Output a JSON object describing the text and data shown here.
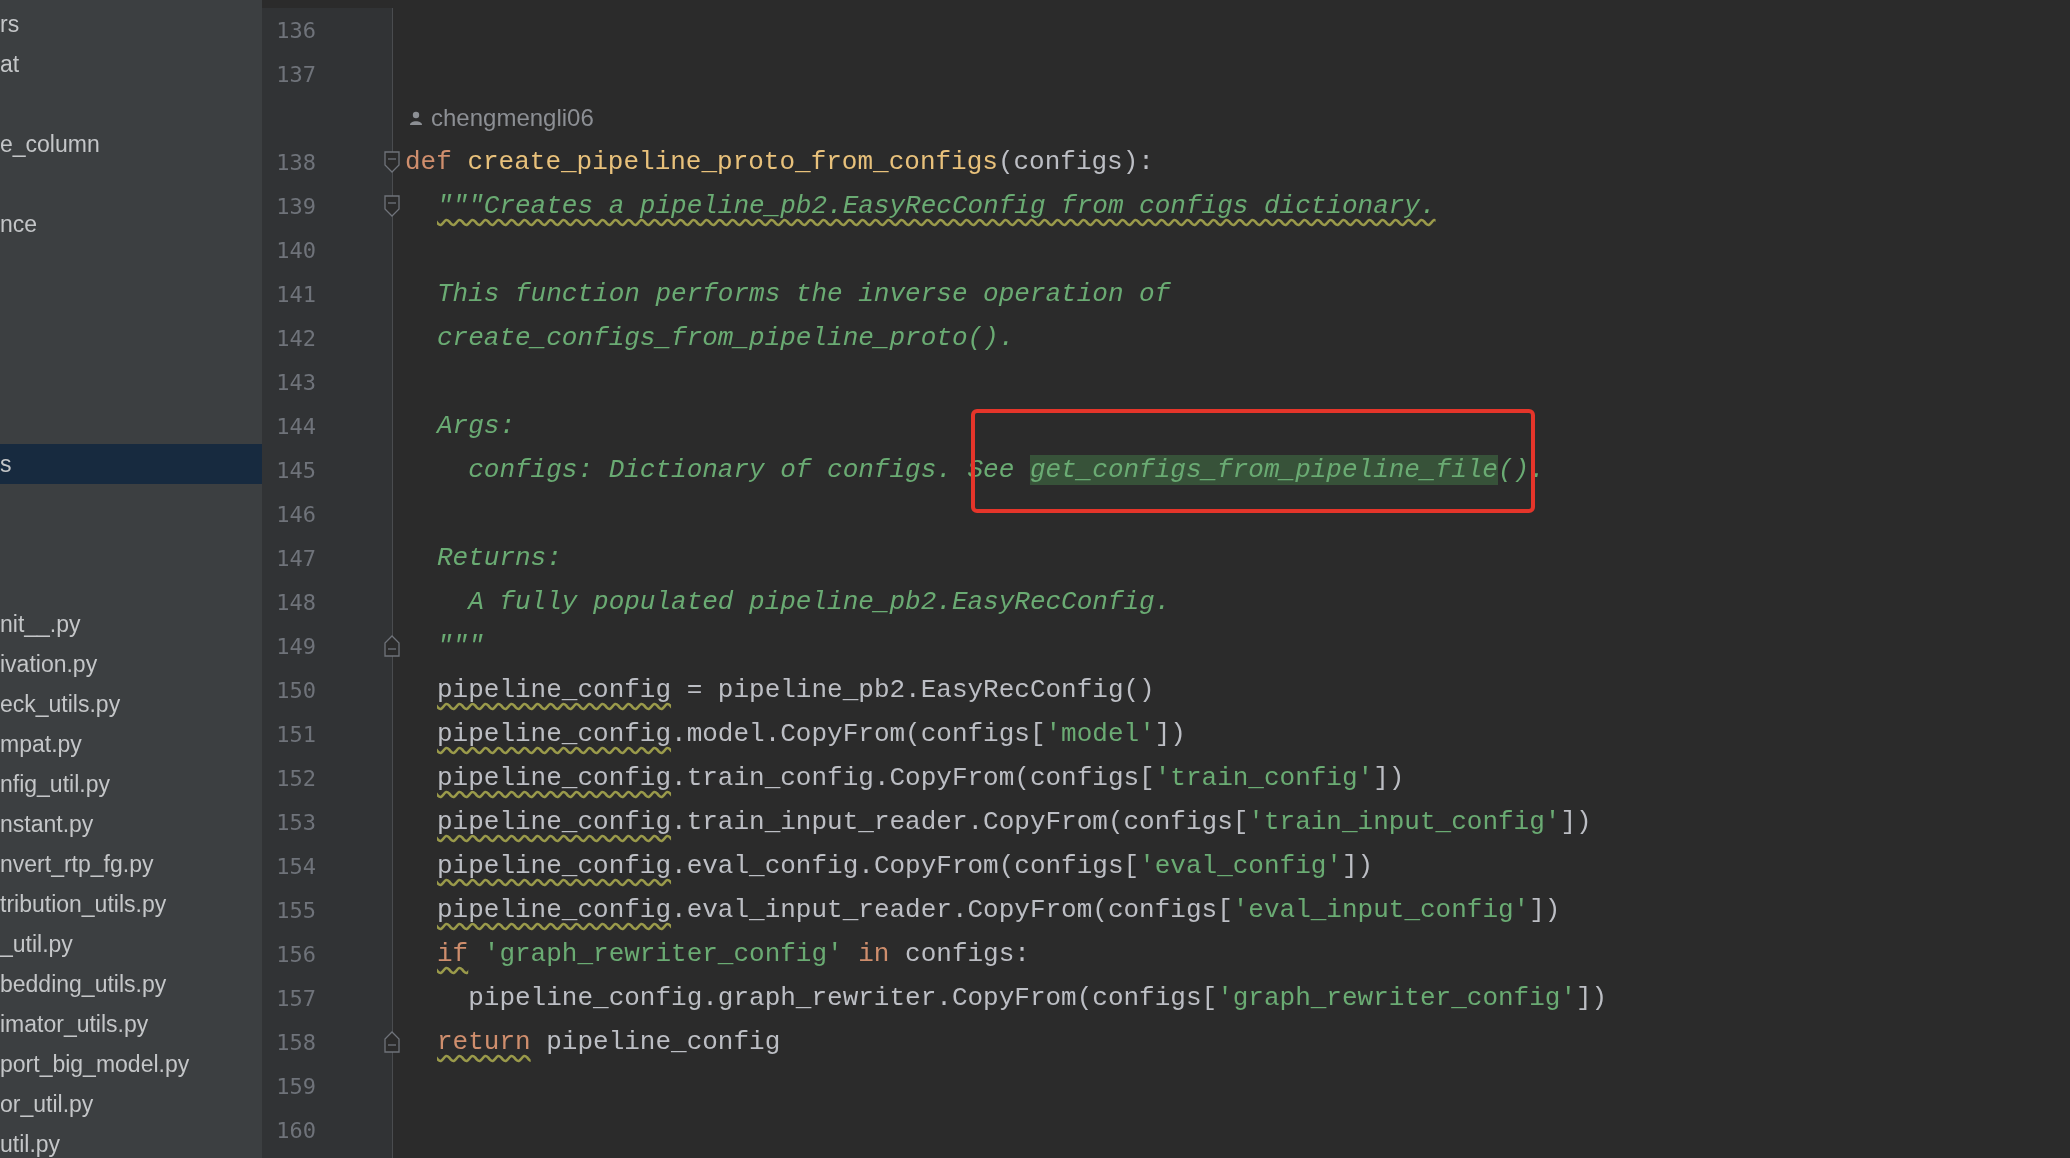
{
  "sidebar": {
    "items": [
      {
        "kind": "file",
        "label": "rs",
        "selected": false
      },
      {
        "kind": "file",
        "label": "at",
        "selected": false
      },
      {
        "kind": "hidden",
        "selected": false
      },
      {
        "kind": "file",
        "label": "e_column",
        "selected": false
      },
      {
        "kind": "hidden",
        "selected": false
      },
      {
        "kind": "file",
        "label": "nce",
        "selected": false
      },
      {
        "kind": "hidden",
        "selected": false
      },
      {
        "kind": "hidden",
        "selected": false
      },
      {
        "kind": "hidden",
        "selected": false
      },
      {
        "kind": "hidden",
        "selected": false
      },
      {
        "kind": "hidden",
        "selected": false
      },
      {
        "kind": "file",
        "label": "s",
        "selected": true
      },
      {
        "kind": "hidden",
        "selected": false
      },
      {
        "kind": "hidden",
        "selected": false
      },
      {
        "kind": "hidden",
        "selected": false
      },
      {
        "kind": "file",
        "label": "nit__.py",
        "selected": false
      },
      {
        "kind": "file",
        "label": "ivation.py",
        "selected": false
      },
      {
        "kind": "file",
        "label": "eck_utils.py",
        "selected": false
      },
      {
        "kind": "file",
        "label": "mpat.py",
        "selected": false
      },
      {
        "kind": "file",
        "label": "nfig_util.py",
        "selected": false
      },
      {
        "kind": "file",
        "label": "nstant.py",
        "selected": false
      },
      {
        "kind": "file",
        "label": "nvert_rtp_fg.py",
        "selected": false
      },
      {
        "kind": "file",
        "label": "tribution_utils.py",
        "selected": false
      },
      {
        "kind": "file",
        "label": "_util.py",
        "selected": false
      },
      {
        "kind": "file",
        "label": "bedding_utils.py",
        "selected": false
      },
      {
        "kind": "file",
        "label": "imator_utils.py",
        "selected": false
      },
      {
        "kind": "file",
        "label": "port_big_model.py",
        "selected": false
      },
      {
        "kind": "file",
        "label": "or_util.py",
        "selected": false
      },
      {
        "kind": "file",
        "label": "util.py",
        "selected": false
      }
    ]
  },
  "editor": {
    "lines": [
      {
        "kind": "code",
        "number": "136"
      },
      {
        "kind": "code",
        "number": "137"
      },
      {
        "kind": "author",
        "author": "chengmengli06"
      },
      {
        "kind": "code",
        "number": "138",
        "indented": false,
        "fold": {
          "kind": "start"
        },
        "segments": [
          {
            "kind": "keyword",
            "text": "def"
          },
          {
            "kind": "function",
            "text": "create_pipeline_proto_from_configs",
            "space_before": true
          },
          {
            "kind": "plain",
            "text": "(configs):"
          }
        ]
      },
      {
        "kind": "code",
        "number": "139",
        "indented": true,
        "fold": {
          "kind": "start"
        },
        "segments": [
          {
            "kind": "doc",
            "text": "\"\"\"Creates a pipeline_pb2.EasyRecConfig from configs dictionary.",
            "warn": true
          }
        ]
      },
      {
        "kind": "code",
        "number": "140"
      },
      {
        "kind": "code",
        "number": "141",
        "indented": true,
        "segments": [
          {
            "kind": "doc",
            "text": "This function performs the inverse operation of"
          }
        ]
      },
      {
        "kind": "code",
        "number": "142",
        "indented": true,
        "segments": [
          {
            "kind": "doc",
            "text": "create_configs_from_pipeline_proto()."
          }
        ]
      },
      {
        "kind": "code",
        "number": "143"
      },
      {
        "kind": "code",
        "number": "144",
        "indented": true,
        "segments": [
          {
            "kind": "doc",
            "text": "Args:"
          }
        ]
      },
      {
        "kind": "code",
        "number": "145",
        "indented": true,
        "segments": [
          {
            "kind": "doc",
            "text": "  configs: Dictionary of configs. See"
          },
          {
            "kind": "highlight",
            "text": "get_configs_from_pipeline_file",
            "boxed": true,
            "space_before": true
          },
          {
            "kind": "doc",
            "text": "()."
          }
        ]
      },
      {
        "kind": "code",
        "number": "146"
      },
      {
        "kind": "code",
        "number": "147",
        "indented": true,
        "segments": [
          {
            "kind": "doc",
            "text": "Returns:"
          }
        ]
      },
      {
        "kind": "code",
        "number": "148",
        "indented": true,
        "segments": [
          {
            "kind": "doc",
            "text": "  A fully populated pipeline_pb2.EasyRecConfig."
          }
        ]
      },
      {
        "kind": "code",
        "number": "149",
        "indented": true,
        "fold": {
          "kind": "end"
        },
        "segments": [
          {
            "kind": "doc",
            "text": "\"\"\""
          }
        ]
      },
      {
        "kind": "code",
        "number": "150",
        "indented": true,
        "segments": [
          {
            "kind": "plain",
            "text": "pipeline_config",
            "warn": true
          },
          {
            "kind": "plain",
            "text": " = pipeline_pb2.EasyRecConfig()"
          }
        ]
      },
      {
        "kind": "code",
        "number": "151",
        "indented": true,
        "segments": [
          {
            "kind": "plain",
            "text": "pipeline_config",
            "warn": true
          },
          {
            "kind": "plain",
            "text": ".model.CopyFrom(configs["
          },
          {
            "kind": "string",
            "text": "'model'"
          },
          {
            "kind": "plain",
            "text": "])"
          }
        ]
      },
      {
        "kind": "code",
        "number": "152",
        "indented": true,
        "segments": [
          {
            "kind": "plain",
            "text": "pipeline_config",
            "warn": true
          },
          {
            "kind": "plain",
            "text": ".train_config.CopyFrom(configs["
          },
          {
            "kind": "string",
            "text": "'train_config'"
          },
          {
            "kind": "plain",
            "text": "])"
          }
        ]
      },
      {
        "kind": "code",
        "number": "153",
        "indented": true,
        "segments": [
          {
            "kind": "plain",
            "text": "pipeline_config",
            "warn": true
          },
          {
            "kind": "plain",
            "text": ".train_input_reader.CopyFrom(configs["
          },
          {
            "kind": "string",
            "text": "'train_input_config'"
          },
          {
            "kind": "plain",
            "text": "])"
          }
        ]
      },
      {
        "kind": "code",
        "number": "154",
        "indented": true,
        "segments": [
          {
            "kind": "plain",
            "text": "pipeline_config",
            "warn": true
          },
          {
            "kind": "plain",
            "text": ".eval_config.CopyFrom(configs["
          },
          {
            "kind": "string",
            "text": "'eval_config'"
          },
          {
            "kind": "plain",
            "text": "])"
          }
        ]
      },
      {
        "kind": "code",
        "number": "155",
        "indented": true,
        "segments": [
          {
            "kind": "plain",
            "text": "pipeline_config",
            "warn": true
          },
          {
            "kind": "plain",
            "text": ".eval_input_reader.CopyFrom(configs["
          },
          {
            "kind": "string",
            "text": "'eval_input_config'"
          },
          {
            "kind": "plain",
            "text": "])"
          }
        ]
      },
      {
        "kind": "code",
        "number": "156",
        "indented": true,
        "segments": [
          {
            "kind": "keyword",
            "text": "if",
            "warn": true
          },
          {
            "kind": "string",
            "text": "'graph_rewriter_config'",
            "space_before": true
          },
          {
            "kind": "keyword",
            "text": "in",
            "space_before": true
          },
          {
            "kind": "plain",
            "text": " configs:"
          }
        ]
      },
      {
        "kind": "code",
        "number": "157",
        "indented": true,
        "segments": [
          {
            "kind": "plain",
            "text": "  pipeline_config.graph_rewriter.CopyFrom(configs["
          },
          {
            "kind": "string",
            "text": "'graph_rewriter_config'"
          },
          {
            "kind": "plain",
            "text": "])"
          }
        ]
      },
      {
        "kind": "code",
        "number": "158",
        "indented": true,
        "fold": {
          "kind": "end"
        },
        "segments": [
          {
            "kind": "keyword",
            "text": "return",
            "warn": true
          },
          {
            "kind": "plain",
            "text": " pipeline_config"
          }
        ]
      },
      {
        "kind": "code",
        "number": "159"
      },
      {
        "kind": "code",
        "number": "160"
      }
    ]
  }
}
